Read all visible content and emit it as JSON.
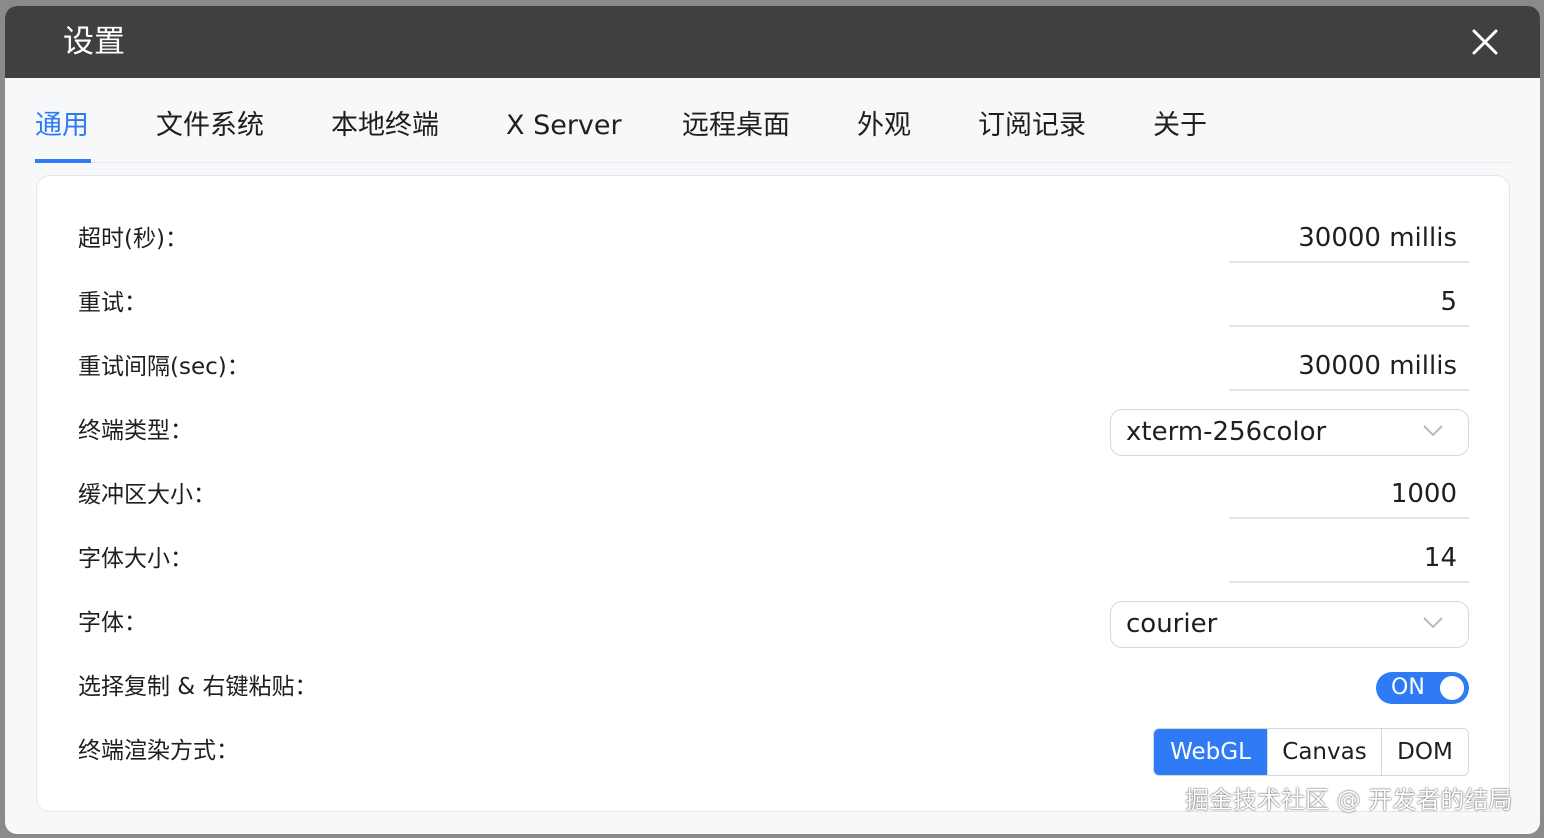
{
  "dialog": {
    "title": "设置",
    "close_icon": "close-icon"
  },
  "tabs": [
    {
      "label": "通用",
      "active": true
    },
    {
      "label": "文件系统",
      "active": false
    },
    {
      "label": "本地终端",
      "active": false
    },
    {
      "label": "X Server",
      "active": false
    },
    {
      "label": "远程桌面",
      "active": false
    },
    {
      "label": "外观",
      "active": false
    },
    {
      "label": "订阅记录",
      "active": false
    },
    {
      "label": "关于",
      "active": false
    }
  ],
  "settings": {
    "timeout": {
      "label": "超时(秒)：",
      "value": "30000 millis"
    },
    "retry": {
      "label": "重试：",
      "value": "5"
    },
    "retry_interval": {
      "label": "重试间隔(sec)：",
      "value": "30000 millis"
    },
    "terminal_type": {
      "label": "终端类型：",
      "value": "xterm-256color"
    },
    "buffer_size": {
      "label": "缓冲区大小：",
      "value": "1000"
    },
    "font_size": {
      "label": "字体大小：",
      "value": "14"
    },
    "font": {
      "label": "字体：",
      "value": "courier"
    },
    "copy_paste": {
      "label": "选择复制 & 右键粘贴：",
      "toggle_label": "ON",
      "enabled": true
    },
    "render_mode": {
      "label": "终端渲染方式：",
      "options": [
        "WebGL",
        "Canvas",
        "DOM"
      ],
      "selected": "WebGL"
    }
  },
  "watermark": "掘金技术社区 @ 开发者的结局",
  "colors": {
    "accent": "#2f7bf5",
    "titlebar": "#404040"
  }
}
